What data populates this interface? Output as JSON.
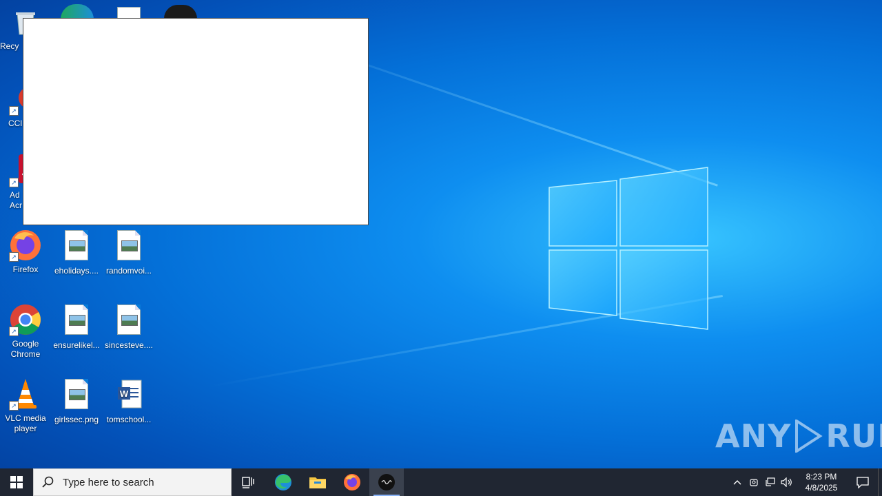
{
  "desktop": {
    "icons": [
      {
        "label": "Recy"
      },
      {
        "label": "CCl"
      },
      {
        "label": "Ad\nAcr"
      },
      {
        "label": "Firefox"
      },
      {
        "label": "eholidays...."
      },
      {
        "label": "randomvoi..."
      },
      {
        "label": "Google Chrome"
      },
      {
        "label": "ensurelikel..."
      },
      {
        "label": "sincesteve...."
      },
      {
        "label": "VLC media player"
      },
      {
        "label": "girlssec.png"
      },
      {
        "label": "tomschool..."
      }
    ]
  },
  "watermark": {
    "left": "ANY",
    "right": "RUN"
  },
  "taskbar": {
    "search_placeholder": "Type here to search",
    "apps": [
      "task-view",
      "edge",
      "file-explorer",
      "firefox",
      "unknown-app"
    ],
    "clock": {
      "time": "8:23 PM",
      "date": "4/8/2025"
    }
  },
  "colors": {
    "accent": "#0a78d8",
    "taskbar": "#202632"
  }
}
